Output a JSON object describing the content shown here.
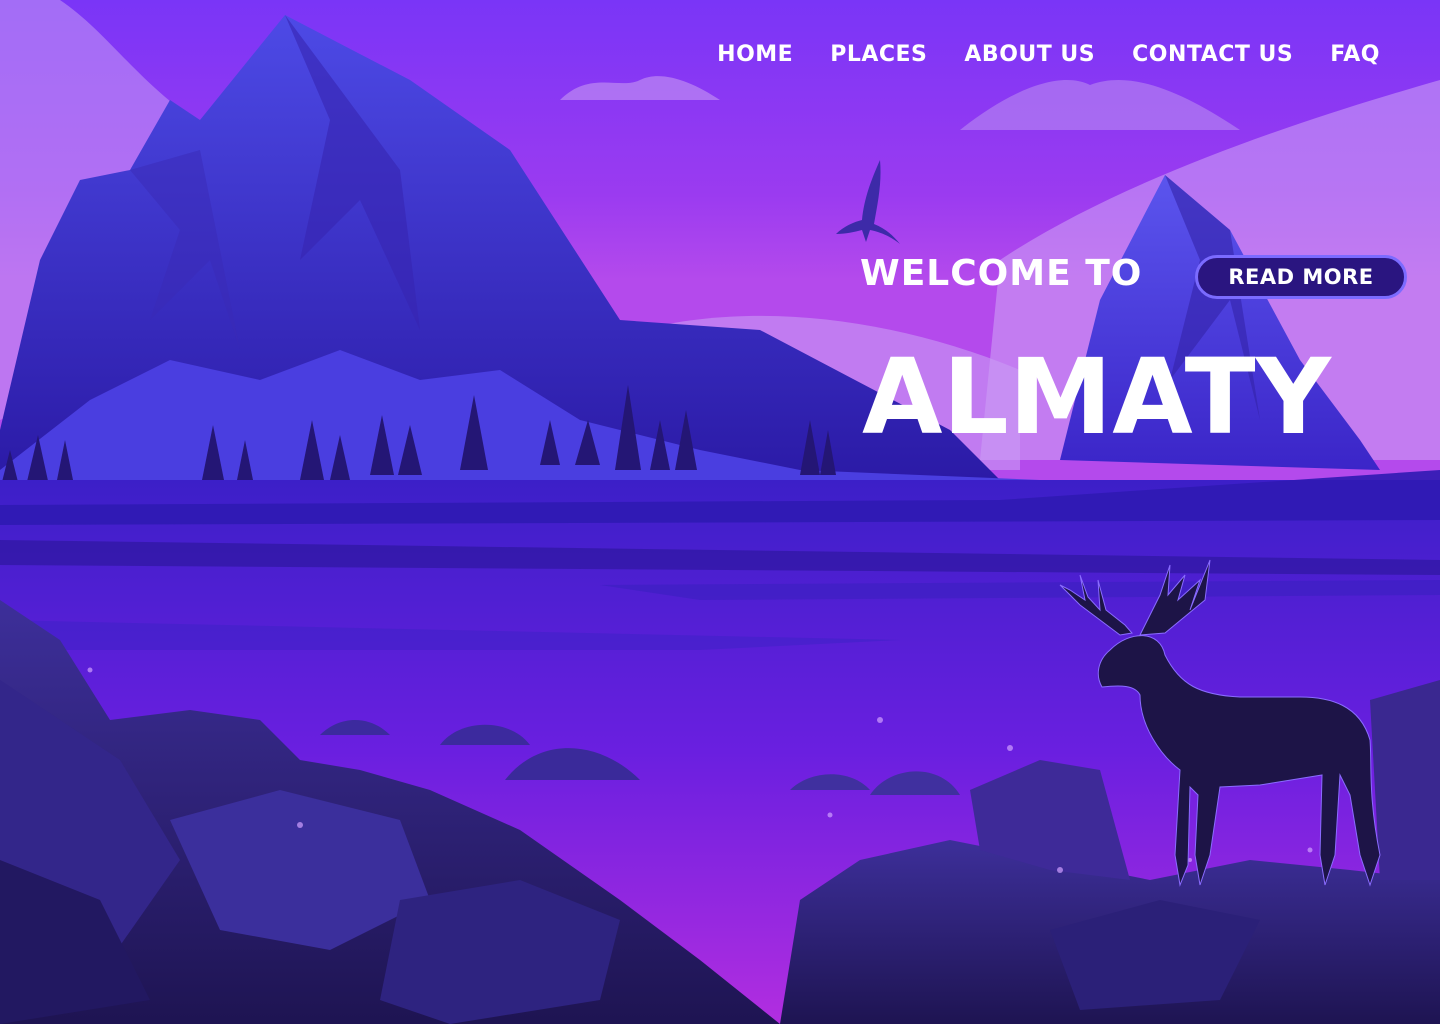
{
  "nav": {
    "items": [
      {
        "label": "HOME"
      },
      {
        "label": "PLACES"
      },
      {
        "label": "ABOUT US"
      },
      {
        "label": "CONTACT US"
      },
      {
        "label": "FAQ"
      }
    ]
  },
  "hero": {
    "welcome": "WELCOME TO",
    "title": "ALMATY",
    "cta_label": "READ MORE"
  },
  "colors": {
    "sky_top": "#7a35f7",
    "sky_mid": "#a03ae8",
    "mountain": "#3a25b8",
    "lake": "#5a1fd9",
    "rocks": "#2a1d6b",
    "deer": "#1d1447",
    "text": "#ffffff"
  },
  "icons": {
    "bird": "bird-icon",
    "deer": "deer-icon"
  }
}
